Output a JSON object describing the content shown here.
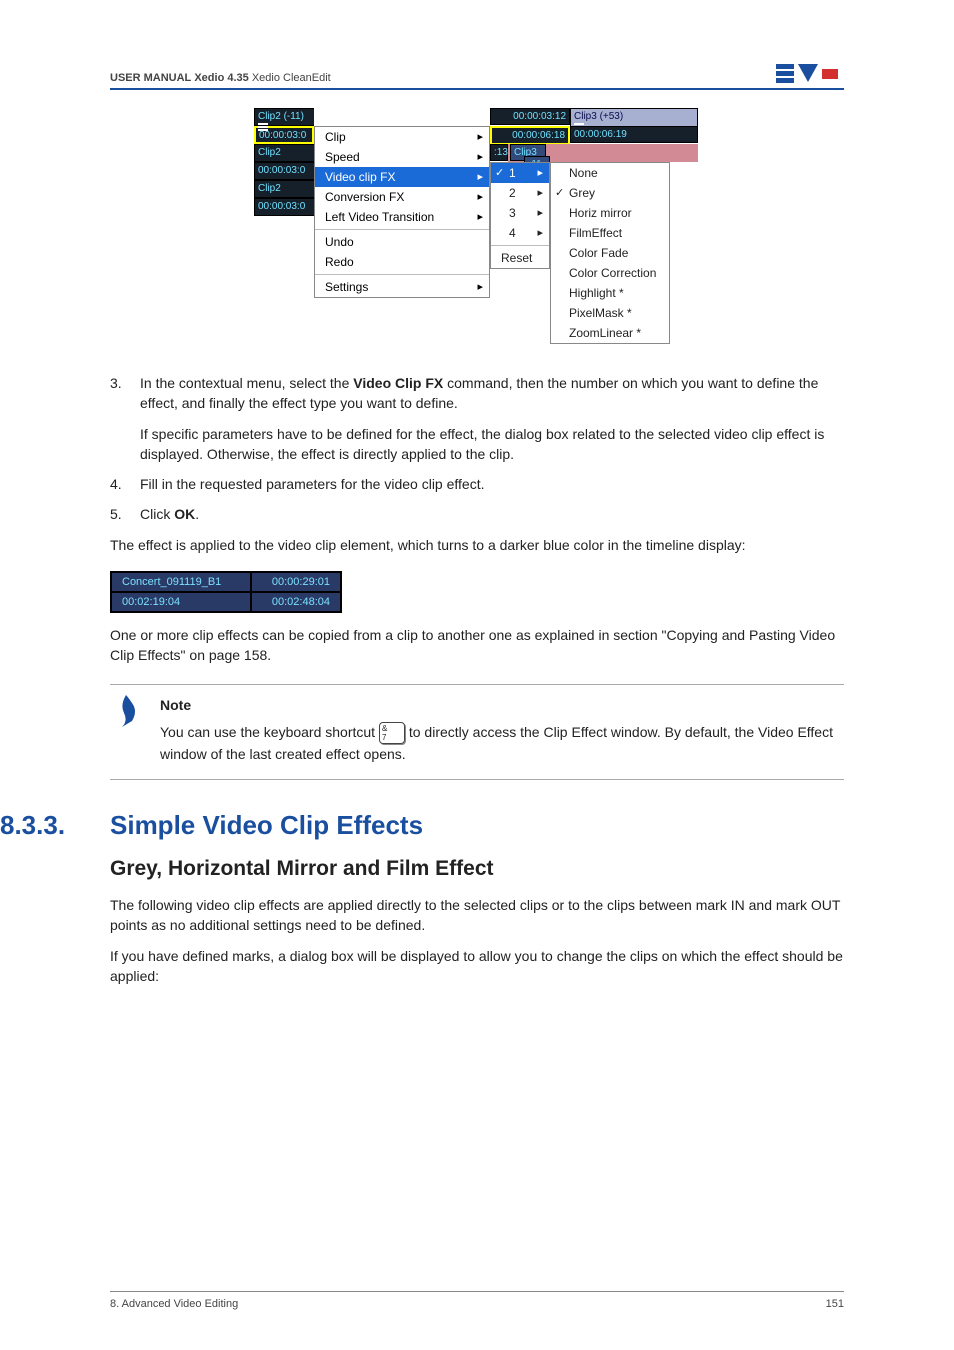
{
  "header": {
    "bold_1": "USER MANUAL",
    "bold_2": "Xedio 4.35",
    "light": "Xedio CleanEdit"
  },
  "fig": {
    "track_hdr_left": "Clip2 (-11)",
    "track_time_left": "00:00:03:0",
    "track_row2_a": "Clip2",
    "track_row2_b": "00:00:03:0",
    "track_row3_a": "Clip2",
    "track_row3_b": "00:00:03:0",
    "top_mid_tc": "00:00:03:12",
    "clip3_hdr": "Clip3 (+53)",
    "top_right_tc": "00:00:06:18",
    "top_right_tc2": "00:00:06:19",
    "badge13": ":13",
    "badge_clip3": "Clip3",
    "badge_minus11": "-11",
    "menu": {
      "clip": "Clip",
      "speed": "Speed",
      "video_clip_fx": "Video clip FX",
      "conversion_fx": "Conversion FX",
      "lvt": "Left Video Transition",
      "undo": "Undo",
      "redo": "Redo",
      "settings": "Settings"
    },
    "sub1": {
      "i1": "1",
      "i2": "2",
      "i3": "3",
      "i4": "4",
      "reset": "Reset"
    },
    "sub2": {
      "none": "None",
      "grey": "Grey",
      "horiz": "Horiz mirror",
      "film": "FilmEffect",
      "fade": "Color Fade",
      "corr": "Color Correction",
      "hl": "Highlight *",
      "px": "PixelMask *",
      "zoom": "ZoomLinear *"
    }
  },
  "list": {
    "n3": "3.",
    "i3a": "In the contextual menu, select the ",
    "i3b": "Video Clip FX",
    "i3c": " command, then the number on which you want to define the effect, and finally the effect type you want to define.",
    "i3_cont": "If specific parameters have to be defined for the effect, the dialog box related to the selected video clip effect is displayed. Otherwise, the effect is directly applied to the clip.",
    "n4": "4.",
    "i4": "Fill in the requested parameters for the video clip effect.",
    "n5": "5.",
    "i5a": "Click ",
    "i5b": "OK",
    "i5c": "."
  },
  "para_after": "The effect is applied to the video clip element, which turns to a darker blue color in the timeline display:",
  "timeline": {
    "a": "Concert_091119_B1",
    "b": "00:00:29:01",
    "c": "00:02:19:04",
    "d": "00:02:48:04"
  },
  "para_copy": "One or more clip effects can be copied from a clip to another one as explained in section \"Copying and Pasting Video Clip Effects\" on page 158.",
  "note": {
    "title": "Note",
    "l1a": "You can use the keyboard shortcut ",
    "key_top": "&",
    "key_bot": "7",
    "l1b": " to directly access the Clip Effect window. By default, the Video Effect window of the last created effect opens."
  },
  "section": {
    "num": "8.3.3.",
    "title": "Simple Video Clip Effects",
    "sub": "Grey, Horizontal Mirror and Film Effect",
    "p1": "The following video clip effects are applied directly to the selected clips or to the clips between mark IN and mark OUT points as no additional settings need to be defined.",
    "p2": "If you have defined marks, a dialog box will be displayed to allow you to change the clips on which the effect should be applied:"
  },
  "footer": {
    "left": "8. Advanced Video Editing",
    "right": "151"
  }
}
